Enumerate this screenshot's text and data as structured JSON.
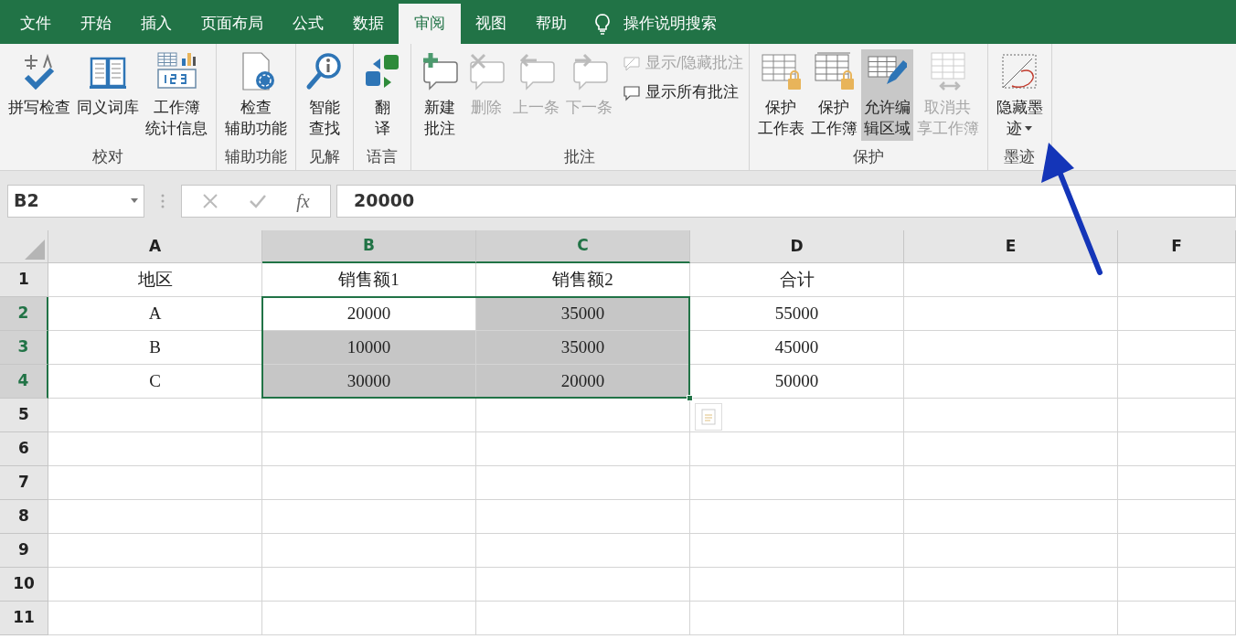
{
  "menu_tabs": [
    {
      "label": "文件",
      "selected": false
    },
    {
      "label": "开始",
      "selected": false
    },
    {
      "label": "插入",
      "selected": false
    },
    {
      "label": "页面布局",
      "selected": false
    },
    {
      "label": "公式",
      "selected": false
    },
    {
      "label": "数据",
      "selected": false
    },
    {
      "label": "审阅",
      "selected": true
    },
    {
      "label": "视图",
      "selected": false
    },
    {
      "label": "帮助",
      "selected": false
    }
  ],
  "search": {
    "label": "操作说明搜索"
  },
  "ribbon_groups": [
    {
      "label": "校对",
      "buttons": [
        {
          "kind": "large",
          "lines": [
            "拼写检查"
          ],
          "disabled": false,
          "selected": false
        },
        {
          "kind": "large",
          "lines": [
            "同义词库"
          ],
          "disabled": false,
          "selected": false
        },
        {
          "kind": "large",
          "lines": [
            "工作簿",
            "统计信息"
          ],
          "disabled": false,
          "selected": false
        }
      ]
    },
    {
      "label": "辅助功能",
      "buttons": [
        {
          "kind": "large",
          "lines": [
            "检查",
            "辅助功能"
          ],
          "disabled": false,
          "selected": false
        }
      ]
    },
    {
      "label": "见解",
      "buttons": [
        {
          "kind": "large",
          "lines": [
            "智能",
            "查找"
          ],
          "disabled": false,
          "selected": false
        }
      ]
    },
    {
      "label": "语言",
      "buttons": [
        {
          "kind": "large",
          "lines": [
            "翻",
            "译"
          ],
          "disabled": false,
          "selected": false
        }
      ]
    },
    {
      "label": "批注",
      "buttons": [
        {
          "kind": "large",
          "lines": [
            "新建",
            "批注"
          ],
          "disabled": false,
          "selected": false
        },
        {
          "kind": "large",
          "lines": [
            "删除"
          ],
          "disabled": true,
          "selected": false
        },
        {
          "kind": "large",
          "lines": [
            "上一条"
          ],
          "disabled": true,
          "selected": false
        },
        {
          "kind": "large",
          "lines": [
            "下一条"
          ],
          "disabled": true,
          "selected": false
        },
        {
          "kind": "small",
          "lines": [
            "显示/隐藏批注"
          ],
          "disabled": true,
          "selected": false
        },
        {
          "kind": "small",
          "lines": [
            "显示所有批注"
          ],
          "disabled": false,
          "selected": false
        }
      ]
    },
    {
      "label": "保护",
      "buttons": [
        {
          "kind": "large",
          "lines": [
            "保护",
            "工作表"
          ],
          "disabled": false,
          "selected": false
        },
        {
          "kind": "large",
          "lines": [
            "保护",
            "工作簿"
          ],
          "disabled": false,
          "selected": false
        },
        {
          "kind": "large",
          "lines": [
            "允许编",
            "辑区域"
          ],
          "disabled": false,
          "selected": true
        },
        {
          "kind": "large",
          "lines": [
            "取消共",
            "享工作簿"
          ],
          "disabled": true,
          "selected": false
        }
      ]
    },
    {
      "label": "墨迹",
      "buttons": [
        {
          "kind": "dropdown",
          "lines": [
            "隐藏墨",
            "迹"
          ],
          "disabled": false,
          "selected": false
        }
      ]
    }
  ],
  "formula_bar": {
    "name_box": "B2",
    "function_label": "fx",
    "value": "20000"
  },
  "columns": [
    {
      "label": "A",
      "selected": false
    },
    {
      "label": "B",
      "selected": true
    },
    {
      "label": "C",
      "selected": true
    },
    {
      "label": "D",
      "selected": false
    },
    {
      "label": "E",
      "selected": false
    },
    {
      "label": "F",
      "selected": false
    }
  ],
  "rows": [
    {
      "header": "1",
      "selected": false,
      "cells": [
        {
          "text": "地区",
          "selected": false
        },
        {
          "text": "销售额1",
          "selected": false
        },
        {
          "text": "销售额2",
          "selected": false
        },
        {
          "text": "合计",
          "selected": false
        }
      ]
    },
    {
      "header": "2",
      "selected": true,
      "cells": [
        {
          "text": "A",
          "selected": false
        },
        {
          "text": "20000",
          "selected": false
        },
        {
          "text": "35000",
          "selected": true
        },
        {
          "text": "55000",
          "selected": false
        }
      ]
    },
    {
      "header": "3",
      "selected": true,
      "cells": [
        {
          "text": "B",
          "selected": false
        },
        {
          "text": "10000",
          "selected": true
        },
        {
          "text": "35000",
          "selected": true
        },
        {
          "text": "45000",
          "selected": false
        }
      ]
    },
    {
      "header": "4",
      "selected": true,
      "cells": [
        {
          "text": "C",
          "selected": false
        },
        {
          "text": "30000",
          "selected": true
        },
        {
          "text": "20000",
          "selected": true
        },
        {
          "text": "50000",
          "selected": false
        }
      ]
    },
    {
      "header": "5",
      "selected": false
    },
    {
      "header": "6",
      "selected": false
    },
    {
      "header": "7",
      "selected": false
    },
    {
      "header": "8",
      "selected": false
    },
    {
      "header": "9",
      "selected": false
    },
    {
      "header": "10",
      "selected": false
    },
    {
      "header": "11",
      "selected": false
    }
  ]
}
